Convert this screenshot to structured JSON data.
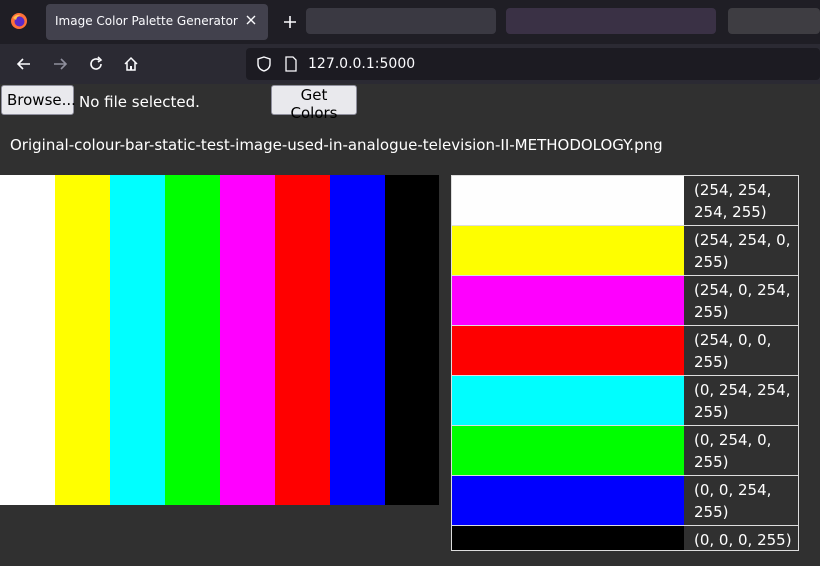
{
  "browser": {
    "tab_title": "Image Color Palette Generator",
    "url": "127.0.0.1:5000"
  },
  "form": {
    "browse_label": "Browse...",
    "file_status": "No file selected.",
    "submit_label": "Get Colors"
  },
  "image": {
    "filename": "Original-colour-bar-static-test-image-used-in-analogue-television-II-METHODOLOGY.png",
    "bars": [
      "#ffffff",
      "#ffff00",
      "#00ffff",
      "#00ff00",
      "#ff00ff",
      "#ff0000",
      "#0000ff",
      "#000000"
    ]
  },
  "palette": [
    {
      "color": "#fefefe",
      "label": "(254, 254, 254, 255)"
    },
    {
      "color": "#fefe00",
      "label": "(254, 254, 0, 255)"
    },
    {
      "color": "#fe00fe",
      "label": "(254, 0, 254, 255)"
    },
    {
      "color": "#fe0000",
      "label": "(254, 0, 0, 255)"
    },
    {
      "color": "#00fefe",
      "label": "(0, 254, 254, 255)"
    },
    {
      "color": "#00fe00",
      "label": "(0, 254, 0, 255)"
    },
    {
      "color": "#0000fe",
      "label": "(0, 0, 254, 255)"
    },
    {
      "color": "#000000",
      "label": "(0, 0, 0, 255)"
    }
  ]
}
